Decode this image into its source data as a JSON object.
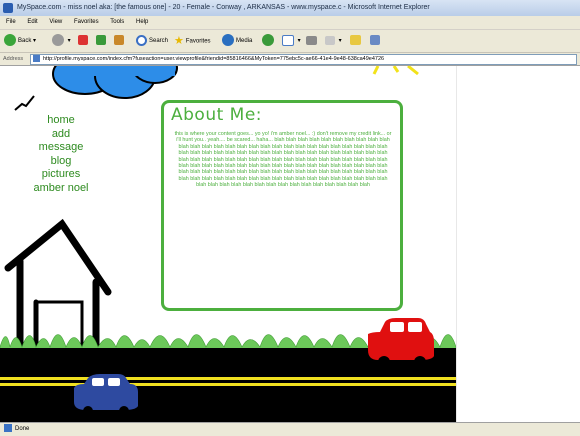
{
  "window": {
    "title": "MySpace.com - miss noel aka: [the famous one] - 20 - Female - Conway , ARKANSAS - www.myspace.c - Microsoft Internet Explorer"
  },
  "menu": [
    "File",
    "Edit",
    "View",
    "Favorites",
    "Tools",
    "Help"
  ],
  "toolbar": {
    "back_label": "Back",
    "search_label": "Search",
    "favorites_label": "Favorites",
    "media_label": "Media"
  },
  "address": {
    "label": "Address",
    "url": "http://profile.myspace.com/index.cfm?fuseaction=user.viewprofile&friendid=85816466&MyToken=775ebc5c-ae66-41e4-9e48-638ca49e4726"
  },
  "nav": [
    "home",
    "add",
    "message",
    "blog",
    "pictures",
    "amber noel"
  ],
  "about": {
    "title": "About Me:",
    "body": "this is where your content goes... yo yo! i'm amber noel... :) don't remove my credit link... or i'll hunt you.. yeah.... be scared... haha... blah blah blah blah blah blah blah blah blah blah blah blah blah blah blah blah blah blah blah blah blah blah blah blah blah blah blah blah blah blah blah blah blah blah blah blah blah blah blah blah blah blah blah blah blah blah blah blah blah blah blah blah blah blah blah blah blah blah blah blah blah blah blah blah blah blah blah blah blah blah blah blah blah blah blah blah blah blah blah blah blah blah blah blah blah blah blah blah blah blah blah blah blah blah blah blah blah blah blah blah blah blah blah blah blah blah blah blah blah blah blah blah blah blah blah blah blah blah blah blah blah blah blah blah blah blah blah blah blah blah blah blah blah"
  },
  "status": {
    "text": "Done"
  },
  "colors": {
    "accent_green": "#4caf3e",
    "car_red": "#e01010",
    "car_blue": "#2e4aa0",
    "road": "#000000",
    "road_stripe": "#f0e020",
    "cloud": "#2d8de8",
    "sun": "#f2e21a"
  }
}
